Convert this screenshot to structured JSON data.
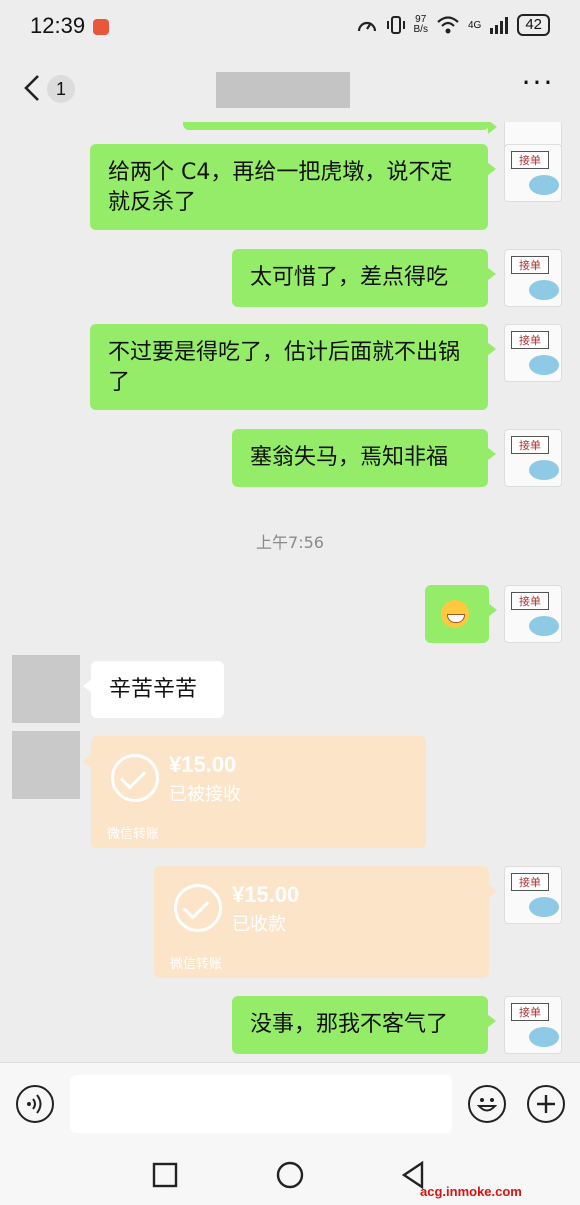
{
  "status_bar": {
    "time": "12:39",
    "app_icon": "notification-app-icon",
    "net_speed_value": "97",
    "net_speed_unit": "B/s",
    "network_type": "4G",
    "battery": "42"
  },
  "nav": {
    "unread_count": "1",
    "more": "···"
  },
  "messages": [
    {
      "side": "me",
      "text": "给两个 C4，再给一把虎墩，说不定就反杀了"
    },
    {
      "side": "me",
      "text": "太可惜了，差点得吃"
    },
    {
      "side": "me",
      "text": "不过要是得吃了，估计后面就不出锅了"
    },
    {
      "side": "me",
      "text": "塞翁失马，焉知非福"
    },
    {
      "timestamp": "上午7:56"
    },
    {
      "side": "me",
      "emoji": "grinning-face"
    },
    {
      "side": "other",
      "text": "辛苦辛苦"
    },
    {
      "side": "other",
      "transfer": {
        "amount": "¥15.00",
        "status": "已被接收",
        "footer": "微信转账"
      }
    },
    {
      "side": "me",
      "transfer": {
        "amount": "¥15.00",
        "status": "已收款",
        "footer": "微信转账"
      }
    },
    {
      "side": "me",
      "text": "没事，那我不客气了"
    }
  ],
  "my_avatar_label": "接单",
  "input": {
    "placeholder": ""
  },
  "watermark": "acg.inmoke.com",
  "colors": {
    "my_bubble": "#95ec69",
    "other_bubble": "#ffffff",
    "transfer": "#fce4c9",
    "background": "#ededed"
  }
}
